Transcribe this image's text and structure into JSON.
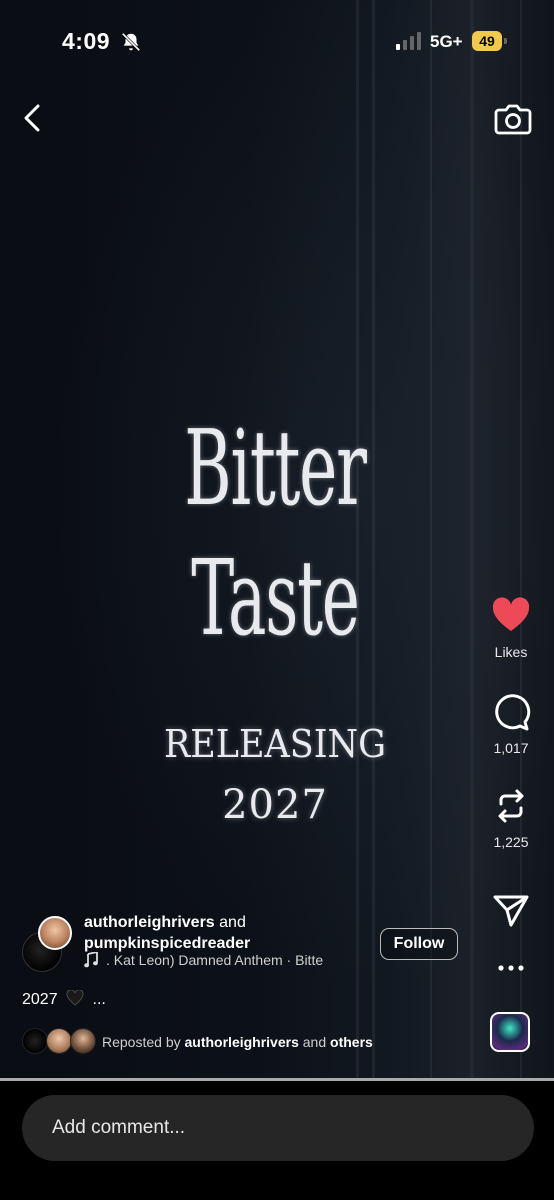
{
  "status_bar": {
    "time": "4:09",
    "network": "5G+",
    "battery": "49",
    "battery_color": "#f2c94c"
  },
  "header": {
    "back_icon": "chevron-left-icon",
    "camera_icon": "camera-icon"
  },
  "video": {
    "title_line1": "Bitter",
    "title_line2": "Taste",
    "release_line": "RELEASING",
    "year": "2027"
  },
  "actions": {
    "like_label": "Likes",
    "like_color": "#ed4956",
    "comment_count": "1,017",
    "repost_count": "1,225",
    "share_icon": "send-icon",
    "more_icon": "more-horizontal-icon"
  },
  "post": {
    "author1": "authorleighrivers",
    "conjunction": "and",
    "author2": "pumpkinspicedreader",
    "audio": ". Kat Leon)      Damned Anthem · Bitte",
    "follow_label": "Follow",
    "caption_text": "2027",
    "caption_more": "...",
    "reposted_by_prefix": "Reposted by",
    "reposted_user": "authorleighrivers",
    "reposted_and": "and",
    "reposted_others": "others"
  },
  "comment_bar": {
    "placeholder": "Add comment..."
  }
}
